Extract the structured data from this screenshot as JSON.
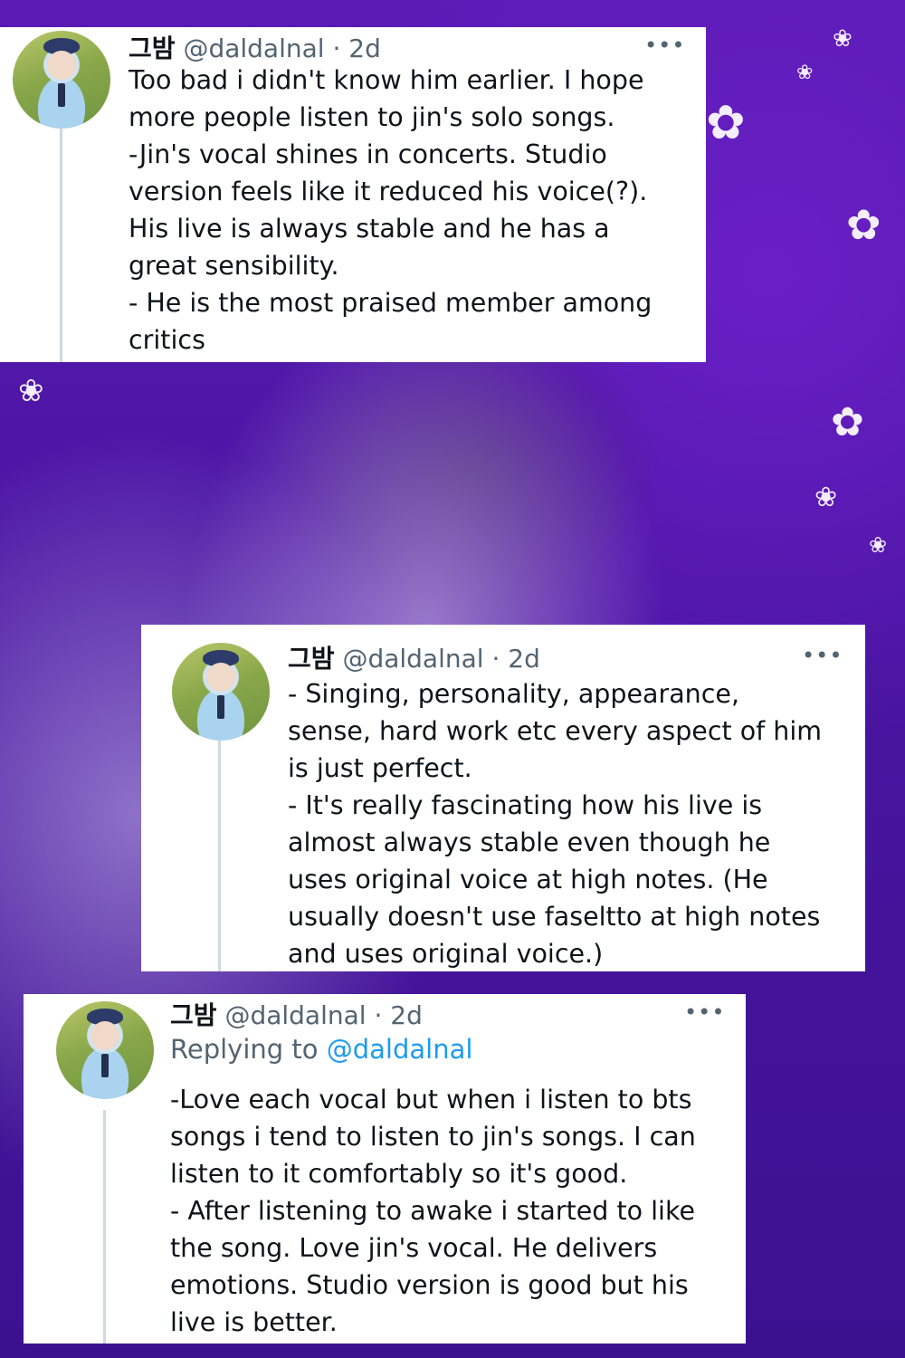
{
  "background": {
    "colors": {
      "primary": "#5a1bb4",
      "highlight": "#6a1fc6",
      "petals": "#f4eefc"
    }
  },
  "colors": {
    "link": "#1d9bf0",
    "text": "#0f1419",
    "muted": "#536471"
  },
  "tweets": [
    {
      "display_name": "그밤",
      "handle": "@daldalnal",
      "separator": "·",
      "time": "2d",
      "more": "•••",
      "lines": [
        "Too bad i didn't know him earlier. I hope",
        "more people listen to jin's solo songs.",
        "-Jin's vocal shines in concerts. Studio",
        "version feels like it reduced his voice(?).",
        "His live is always stable and he has a",
        "great sensibility.",
        "- He is the most praised member among",
        "critics"
      ]
    },
    {
      "display_name": "그밤",
      "handle": "@daldalnal",
      "separator": "·",
      "time": "2d",
      "more": "•••",
      "lines": [
        "- Singing, personality, appearance,",
        "sense, hard work etc every aspect of him",
        "is just perfect.",
        "- It's really fascinating how his live is",
        "almost always stable even though he",
        "uses original voice at high notes. (He",
        "usually doesn't use faseltto at high notes",
        "and uses original voice.)"
      ]
    },
    {
      "display_name": "그밤",
      "handle": "@daldalnal",
      "separator": "·",
      "time": "2d",
      "more": "•••",
      "replying_prefix": "Replying to ",
      "replying_handle": "@daldalnal",
      "lines": [
        "-Love each vocal but when i listen to bts",
        "songs i tend to listen to jin's songs.  I can",
        "listen to it comfortably so it's good.",
        "- After listening to awake i started to like",
        "the song. Love jin's vocal. He delivers",
        "emotions. Studio version is good but his",
        "live is better."
      ]
    }
  ]
}
